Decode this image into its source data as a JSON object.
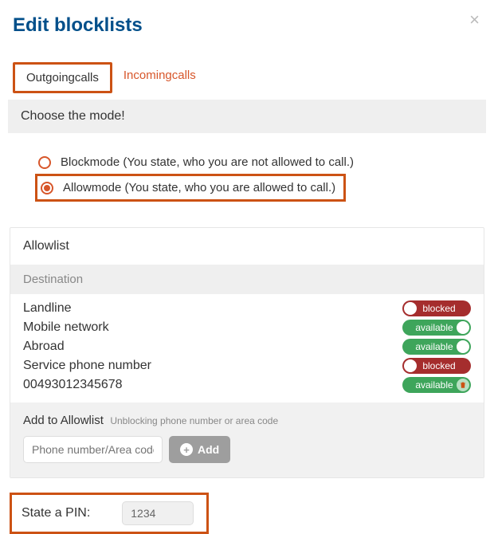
{
  "title": "Edit blocklists",
  "tabs": {
    "outgoing": "Outgoingcalls",
    "incoming": "Incomingcalls",
    "active": "outgoing"
  },
  "mode_section": {
    "heading": "Choose the mode!",
    "block_label": "Blockmode (You state, who you are not allowed to call.)",
    "allow_label": "Allowmode (You state, who you are allowed to call.)",
    "selected": "allow"
  },
  "allowlist": {
    "heading": "Allowlist",
    "col_destination": "Destination",
    "rows": [
      {
        "dest": "Landline",
        "state": "blocked",
        "label": "blocked"
      },
      {
        "dest": "Mobile network",
        "state": "available",
        "label": "available"
      },
      {
        "dest": "Abroad",
        "state": "available",
        "label": "available"
      },
      {
        "dest": "Service phone number",
        "state": "blocked",
        "label": "blocked"
      },
      {
        "dest": "00493012345678",
        "state": "available",
        "label": "available",
        "deletable": true
      }
    ],
    "add": {
      "label": "Add to Allowlist",
      "hint": "Unblocking phone number or area code",
      "placeholder": "Phone number/Area code",
      "button": "Add"
    }
  },
  "pin": {
    "label": "State a PIN:",
    "value": "1234"
  }
}
